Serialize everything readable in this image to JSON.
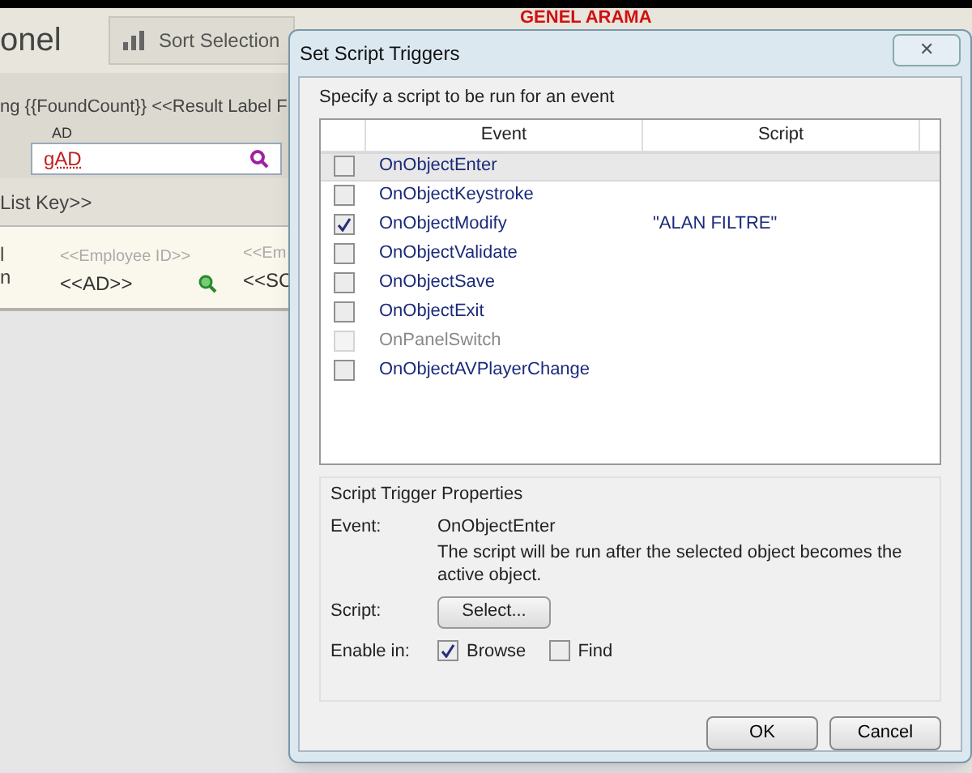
{
  "background": {
    "title": "onel",
    "sort_button": "Sort Selection",
    "layout_title": "GENEL ARAMA",
    "found_text": "ng {{FoundCount}} <<Result Label F",
    "field_label": "AD",
    "field_value": "gAD",
    "list_key": "List Key>>",
    "row_label_1": "l",
    "row_label_2": "n",
    "employee_id": "<<Employee ID>>",
    "ad_field": "<<AD>>",
    "col3_top": "<<Em",
    "col3_bottom": "<<SC"
  },
  "dialog": {
    "title": "Set Script Triggers",
    "close": "✕",
    "group_title": "Specify a script to be run for an event",
    "columns": [
      "Event",
      "Script"
    ],
    "rows": [
      {
        "event": "OnObjectEnter",
        "script": "",
        "checked": false,
        "disabled": false,
        "selected": true
      },
      {
        "event": "OnObjectKeystroke",
        "script": "",
        "checked": false,
        "disabled": false,
        "selected": false
      },
      {
        "event": "OnObjectModify",
        "script": "\"ALAN FILTRE\"",
        "checked": true,
        "disabled": false,
        "selected": false
      },
      {
        "event": "OnObjectValidate",
        "script": "",
        "checked": false,
        "disabled": false,
        "selected": false
      },
      {
        "event": "OnObjectSave",
        "script": "",
        "checked": false,
        "disabled": false,
        "selected": false
      },
      {
        "event": "OnObjectExit",
        "script": "",
        "checked": false,
        "disabled": false,
        "selected": false
      },
      {
        "event": "OnPanelSwitch",
        "script": "",
        "checked": false,
        "disabled": true,
        "selected": false
      },
      {
        "event": "OnObjectAVPlayerChange",
        "script": "",
        "checked": false,
        "disabled": false,
        "selected": false
      }
    ],
    "properties": {
      "title": "Script Trigger Properties",
      "event_label": "Event:",
      "event_name": "OnObjectEnter",
      "description": "The script will be run after the selected object becomes the active object.",
      "script_label": "Script:",
      "select_button": "Select...",
      "enable_label": "Enable in:",
      "modes": [
        {
          "label": "Browse",
          "checked": true
        },
        {
          "label": "Find",
          "checked": false
        }
      ]
    },
    "buttons": [
      "OK",
      "Cancel"
    ]
  }
}
